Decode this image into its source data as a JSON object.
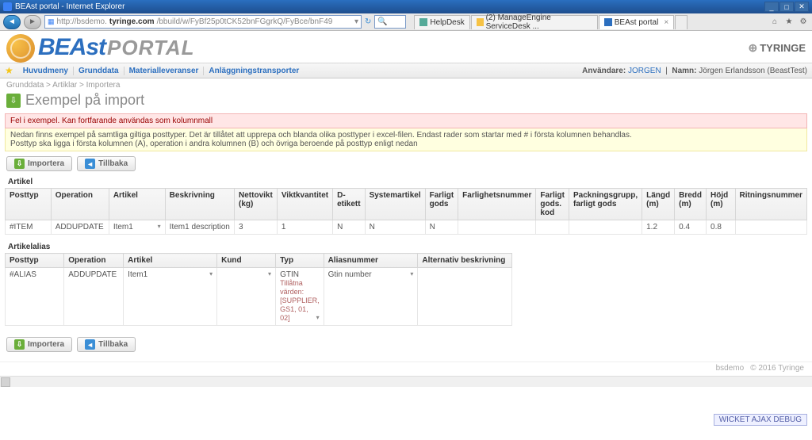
{
  "window": {
    "title": "BEAst portal - Internet Explorer",
    "url_prefix": "http://bsdemo.",
    "url_domain": "tyringe.com",
    "url_path": "/bbuild/w/FyBf25p0tCK52bnFGgrkQ/FyBce/bnF49",
    "tabs": [
      {
        "label": "HelpDesk"
      },
      {
        "label": "(2) ManageEngine ServiceDesk ..."
      },
      {
        "label": "BEAst portal"
      }
    ]
  },
  "brand": {
    "beast": "BEAst",
    "portal": "PORTAL",
    "tyringe": "TYRINGE"
  },
  "menu": {
    "items": [
      "Huvudmeny",
      "Grunddata",
      "Materialleveranser",
      "Anläggningstransporter"
    ],
    "user_label": "Användare:",
    "user_value": "JORGEN",
    "name_label": "Namn:",
    "name_value": "Jörgen Erlandsson (BeastTest)"
  },
  "breadcrumbs": [
    "Grunddata",
    "Artiklar",
    "Importera"
  ],
  "page_title": "Exempel på import",
  "error_text": "Fel i exempel. Kan fortfarande användas som kolumnmall",
  "info_text": "Nedan finns exempel på samtliga giltiga posttyper. Det är tillåtet att upprepa och blanda olika posttyper i excel-filen. Endast rader som startar med # i första kolumnen behandlas.\nPosttyp ska ligga i första kolumnen (A), operation i andra kolumnen (B) och övriga beroende på posttyp enligt nedan",
  "buttons": {
    "import": "Importera",
    "back": "Tillbaka"
  },
  "artikel": {
    "title": "Artikel",
    "headers": [
      "Posttyp",
      "Operation",
      "Artikel",
      "Beskrivning",
      "Nettovikt (kg)",
      "Viktkvantitet",
      "D-etikett",
      "Systemartikel",
      "Farligt gods",
      "Farlighetsnummer",
      "Farligt gods. kod",
      "Packningsgrupp, farligt gods",
      "Längd (m)",
      "Bredd (m)",
      "Höjd (m)",
      "Ritningsnummer"
    ],
    "row": [
      "#ITEM",
      "ADDUPDATE",
      "Item1",
      "Item1 description",
      "3",
      "1",
      "N",
      "N",
      "N",
      "",
      "",
      "",
      "1.2",
      "0.4",
      "0.8",
      ""
    ]
  },
  "alias": {
    "title": "Artikelalias",
    "headers": [
      "Posttyp",
      "Operation",
      "Artikel",
      "Kund",
      "Typ",
      "Aliasnummer",
      "Alternativ beskrivning"
    ],
    "row": {
      "posttyp": "#ALIAS",
      "operation": "ADDUPDATE",
      "artikel": "Item1",
      "kund": "",
      "typ_value": "GTIN",
      "typ_allowed": "Tillåtna värden: [SUPPLIER, GS1, 01, 02]",
      "aliasnr": "Gtin number",
      "altbesk": ""
    }
  },
  "footer": {
    "left": "bsdemo",
    "right": "© 2016 Tyringe"
  },
  "debug": "WICKET AJAX DEBUG"
}
